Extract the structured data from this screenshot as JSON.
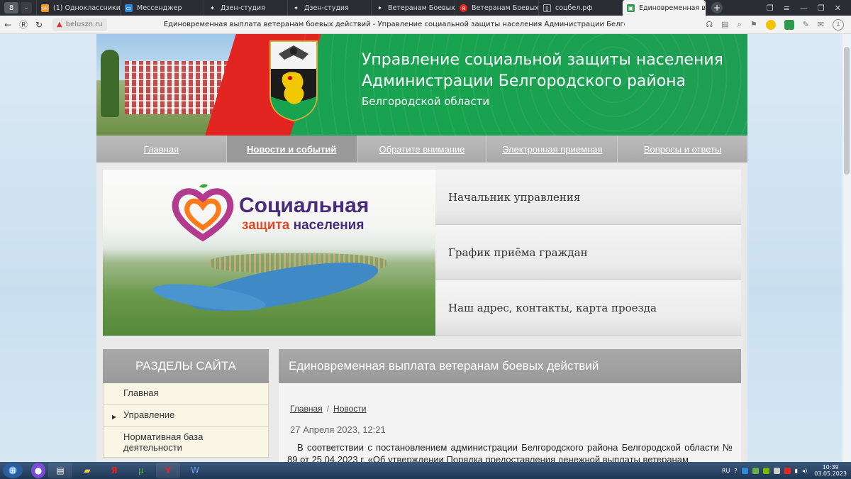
{
  "browser": {
    "tab_count": "8",
    "tabs": [
      {
        "label": "(1) Одноклассники",
        "color": "#f7931e",
        "glyph": "ok"
      },
      {
        "label": "Мессенджер",
        "color": "#2b88d9",
        "glyph": "chat"
      },
      {
        "label": "Дзен-студия",
        "color": "#222222",
        "glyph": "zen"
      },
      {
        "label": "Дзен-студия",
        "color": "#222222",
        "glyph": "zen"
      },
      {
        "label": "Ветеранам Боевых Дейс",
        "color": "#222222",
        "glyph": "zen"
      },
      {
        "label": "Ветеранам Боевых Дейс",
        "color": "#e52620",
        "glyph": "ya"
      },
      {
        "label": "соцбел.рф",
        "color": "#888888",
        "glyph": "page"
      },
      {
        "label": "Единовременная выг",
        "color": "#2e9a4c",
        "glyph": "site",
        "active": true
      }
    ],
    "domain": "beluszn.ru",
    "page_title": "Единовременная выплата ветеранам боевых действий - Управление социальной защиты населения Администрации Белгородского района"
  },
  "site": {
    "title_line1": "Управление социальной защиты населения",
    "title_line2": "Администрации Белгородского района",
    "subtitle": "Белгородской области",
    "nav": [
      "Главная",
      "Новости и событий",
      "Обратите внимание",
      "Электронная приемная",
      "Вопросы и ответы"
    ],
    "nav_active_index": 1,
    "hero": {
      "logo_line1": "Социальная",
      "logo_line2a": "защита",
      "logo_line2b": "населения",
      "links": [
        "Начальник управления",
        "График приёма граждан",
        "Наш адрес, контакты, карта проезда"
      ]
    },
    "sidebar": {
      "heading": "РАЗДЕЛЫ САЙТА",
      "items": [
        "Главная",
        "Управление",
        "Нормативная база деятельности"
      ]
    },
    "article": {
      "heading": "Единовременная выплата ветеранам боевых действий",
      "crumb_home": "Главная",
      "crumb_section": "Новости",
      "date": "27 Апреля 2023, 12:21",
      "body": "В соответствии с постановлением администрации Белгородского района Белгородской области № 89 от 25.04.2023 г. «Об утверждении Порядка предоставления денежной выплаты ветеранам"
    }
  },
  "taskbar": {
    "lang": "RU",
    "time": "10:39",
    "date": "03.05.2023"
  },
  "colors": {
    "banner_green": "#18a34f",
    "banner_red": "#e32521",
    "nav_grey": "#a9a9a9",
    "taskbar": "#1f3756"
  }
}
